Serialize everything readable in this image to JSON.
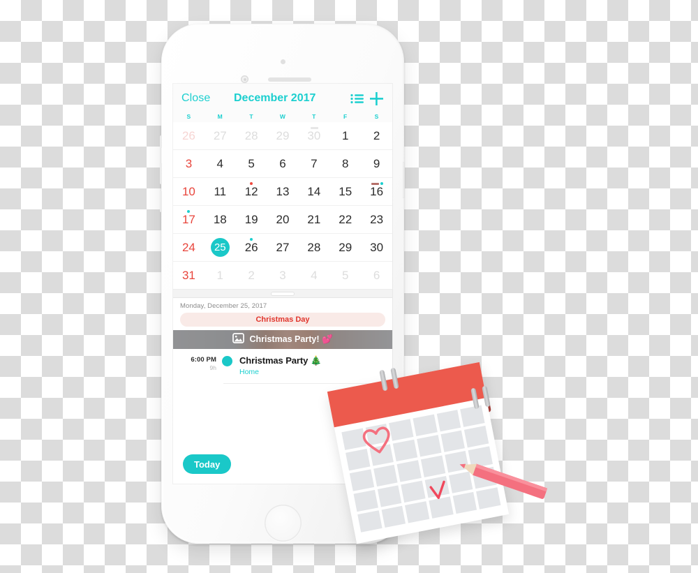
{
  "app": {
    "platform": "ios-phone-mockup",
    "accent_teal": "#1ccfcf",
    "accent_red": "#e8453c",
    "deco_red": "#ec5a4d",
    "deco_pink": "#f4707f"
  },
  "navbar": {
    "close_label": "Close",
    "month_title": "December 2017",
    "list_icon": "list-icon",
    "add_icon": "plus-icon"
  },
  "weekdays": [
    "S",
    "M",
    "T",
    "W",
    "T",
    "F",
    "S"
  ],
  "calendar": {
    "weeks": [
      [
        {
          "n": "26",
          "out": true,
          "sun": true
        },
        {
          "n": "27",
          "out": true
        },
        {
          "n": "28",
          "out": true
        },
        {
          "n": "29",
          "out": true
        },
        {
          "n": "30",
          "out": true,
          "bar": "#e7e7e7"
        },
        {
          "n": "1"
        },
        {
          "n": "2"
        }
      ],
      [
        {
          "n": "3",
          "sun": true
        },
        {
          "n": "4"
        },
        {
          "n": "5"
        },
        {
          "n": "6"
        },
        {
          "n": "7"
        },
        {
          "n": "8"
        },
        {
          "n": "9"
        }
      ],
      [
        {
          "n": "10",
          "sun": true
        },
        {
          "n": "11"
        },
        {
          "n": "12",
          "dot": "#f0493f"
        },
        {
          "n": "13"
        },
        {
          "n": "14"
        },
        {
          "n": "15"
        },
        {
          "n": "16",
          "bar": "#b6706a",
          "dot2": "#1ccfcf"
        }
      ],
      [
        {
          "n": "17",
          "sun": true,
          "dot": "#1ccfcf"
        },
        {
          "n": "18"
        },
        {
          "n": "19"
        },
        {
          "n": "20"
        },
        {
          "n": "21"
        },
        {
          "n": "22"
        },
        {
          "n": "23"
        }
      ],
      [
        {
          "n": "24",
          "sun": true
        },
        {
          "n": "25",
          "today": true
        },
        {
          "n": "26",
          "dot": "#1ccfcf"
        },
        {
          "n": "27"
        },
        {
          "n": "28"
        },
        {
          "n": "29"
        },
        {
          "n": "30"
        }
      ],
      [
        {
          "n": "31",
          "sun": true
        },
        {
          "n": "1",
          "out": true
        },
        {
          "n": "2",
          "out": true
        },
        {
          "n": "3",
          "out": true
        },
        {
          "n": "4",
          "out": true
        },
        {
          "n": "5",
          "out": true
        },
        {
          "n": "6",
          "out": true
        }
      ]
    ]
  },
  "day_detail": {
    "date_label": "Monday, December 25, 2017",
    "holiday_label": "Christmas Day",
    "photo_banner": {
      "icon": "photo-icon",
      "label": "Christmas Party! 💕"
    },
    "event": {
      "time": "6:00 PM",
      "duration": "9h",
      "title": "Christmas Party 🎄",
      "location": "Home"
    }
  },
  "today_button": {
    "label": "Today"
  },
  "decoration": {
    "name": "wall-calendar-illustration",
    "elements": [
      "spiral-rings",
      "heart-doodle",
      "checkmark-doodle",
      "pink-pencil"
    ]
  }
}
